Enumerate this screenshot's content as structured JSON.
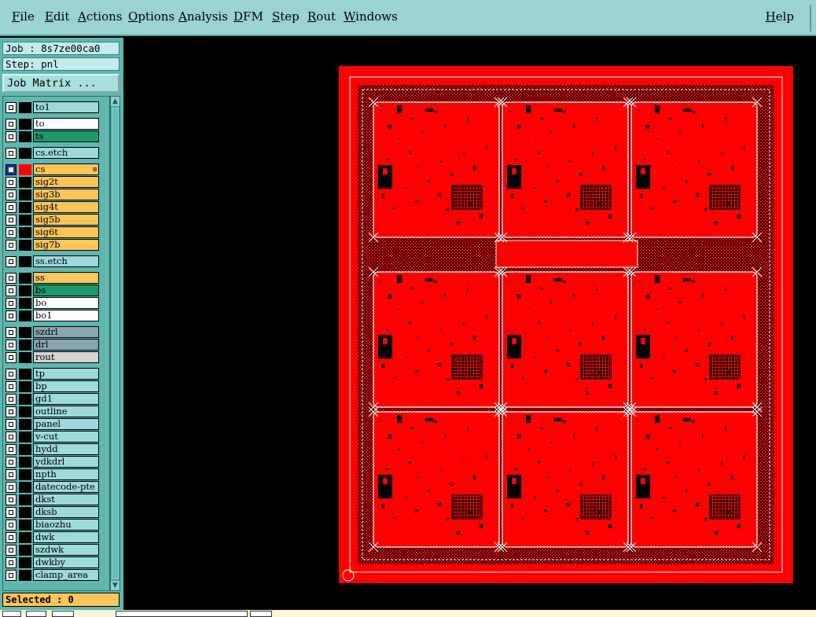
{
  "menubar": {
    "items": [
      "File",
      "Edit",
      "Actions",
      "Options",
      "Analysis",
      "DFM",
      "Step",
      "Rout",
      "Windows"
    ],
    "help": "Help"
  },
  "info": {
    "job": "Job : 8s7ze00ca0",
    "step": "Step: pnl"
  },
  "job_matrix_button": "Job Matrix ...",
  "layers": [
    {
      "name": "to1",
      "color": "board",
      "swatch": "black",
      "active": false
    },
    {
      "name": "to",
      "color": "white",
      "swatch": "black",
      "active": false
    },
    {
      "name": "ts",
      "color": "green",
      "swatch": "black",
      "active": false
    },
    {
      "name": "cs.etch",
      "color": "board",
      "swatch": "black",
      "active": false
    },
    {
      "name": "cs",
      "color": "sig",
      "swatch": "red",
      "active": true
    },
    {
      "name": "sig2t",
      "color": "sig",
      "swatch": "black",
      "active": false
    },
    {
      "name": "sig3b",
      "color": "sig",
      "swatch": "black",
      "active": false
    },
    {
      "name": "sig4t",
      "color": "sig",
      "swatch": "black",
      "active": false
    },
    {
      "name": "sig5b",
      "color": "sig",
      "swatch": "black",
      "active": false
    },
    {
      "name": "sig6t",
      "color": "sig",
      "swatch": "black",
      "active": false
    },
    {
      "name": "sig7b",
      "color": "sig",
      "swatch": "black",
      "active": false
    },
    {
      "name": "ss.etch",
      "color": "board",
      "swatch": "black",
      "active": false
    },
    {
      "name": "ss",
      "color": "sig",
      "swatch": "black",
      "active": false
    },
    {
      "name": "bs",
      "color": "green",
      "swatch": "black",
      "active": false
    },
    {
      "name": "bo",
      "color": "white",
      "swatch": "black",
      "active": false
    },
    {
      "name": "bo1",
      "color": "white",
      "swatch": "black",
      "active": false
    },
    {
      "name": "szdrl",
      "color": "drill",
      "swatch": "black",
      "active": false
    },
    {
      "name": "drl",
      "color": "drill",
      "swatch": "black",
      "active": false
    },
    {
      "name": "rout",
      "color": "grey",
      "swatch": "black",
      "active": false
    },
    {
      "name": "tp",
      "color": "board",
      "swatch": "black",
      "active": false
    },
    {
      "name": "bp",
      "color": "board",
      "swatch": "black",
      "active": false
    },
    {
      "name": "gd1",
      "color": "board",
      "swatch": "black",
      "active": false
    },
    {
      "name": "outline",
      "color": "board",
      "swatch": "black",
      "active": false
    },
    {
      "name": "panel",
      "color": "board",
      "swatch": "black",
      "active": false
    },
    {
      "name": "v-cut",
      "color": "board",
      "swatch": "black",
      "active": false
    },
    {
      "name": "hydd",
      "color": "board",
      "swatch": "black",
      "active": false
    },
    {
      "name": "ydkdrl",
      "color": "board",
      "swatch": "black",
      "active": false
    },
    {
      "name": "npth",
      "color": "board",
      "swatch": "black",
      "active": false
    },
    {
      "name": "datecode-pte",
      "color": "board",
      "swatch": "black",
      "active": false
    },
    {
      "name": "dkst",
      "color": "board",
      "swatch": "black",
      "active": false
    },
    {
      "name": "dksb",
      "color": "board",
      "swatch": "black",
      "active": false
    },
    {
      "name": "biaozhu",
      "color": "board",
      "swatch": "black",
      "active": false
    },
    {
      "name": "dwk",
      "color": "board",
      "swatch": "black",
      "active": false
    },
    {
      "name": "szdwk",
      "color": "board",
      "swatch": "black",
      "active": false
    },
    {
      "name": "dwkby",
      "color": "board",
      "swatch": "black",
      "active": false
    },
    {
      "name": "clamp_area",
      "color": "board",
      "swatch": "black",
      "active": false
    }
  ],
  "selected": "Selected : 0",
  "colors": {
    "menubar": "#9ad3d0",
    "panel_bg": "#5fb7b0",
    "signal_layer": "#fdc55a",
    "copper_display": "#ff0000",
    "graphic_bg": "#000000"
  }
}
